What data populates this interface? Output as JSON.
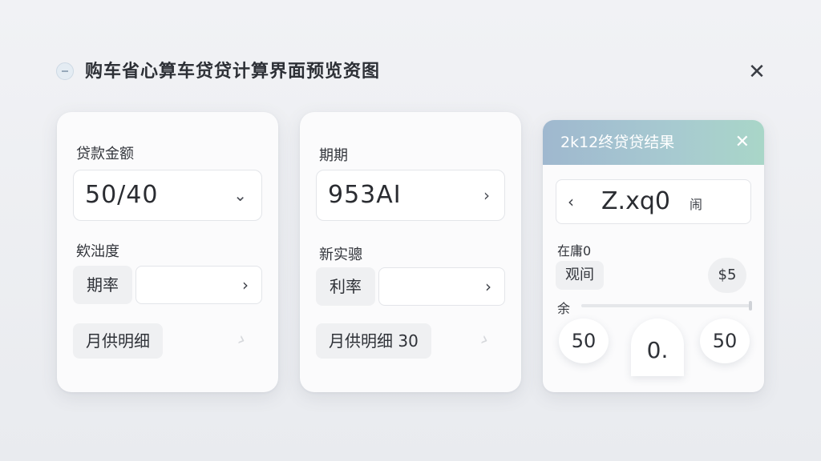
{
  "header": {
    "title": "购车省心算车贷贷计算界面预览资图",
    "close_icon": "close-icon",
    "logo_icon": "minus-circle-icon"
  },
  "card1": {
    "amount_label": "贷款金额",
    "amount_value": "50/40",
    "rate_label": "欸泏度",
    "rate_pill": "期率",
    "detail_label": "月供明细"
  },
  "card2": {
    "term_label": "期期",
    "term_value": "953AI",
    "rate_label": "新实骢",
    "rate_pill": "利率",
    "detail_label": "月供明细 30"
  },
  "result": {
    "title": "2k12终贷贷结果",
    "value": "Z.xq0",
    "unit": "闹",
    "label": "在庸0",
    "tag": "观间",
    "badge": "$5",
    "small_label": "余",
    "slider_level": 1.0,
    "circles": [
      "50",
      "0.",
      "50"
    ]
  },
  "colors": {
    "result_header_start": "#9fb8cf",
    "result_header_end": "#a9d6c8",
    "background": "#eceef1"
  }
}
